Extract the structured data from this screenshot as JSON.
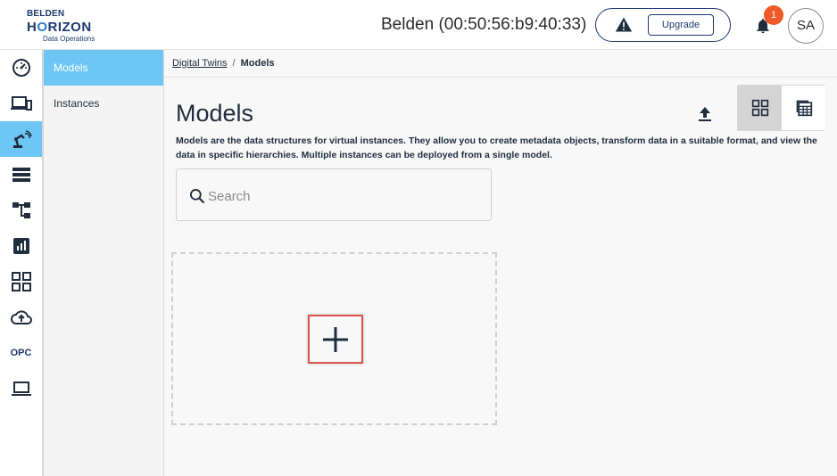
{
  "header": {
    "logo": {
      "line1": "BELDEN",
      "line2_a": "H",
      "line2_o": "O",
      "line2_b": "RIZON",
      "line3": "Data Operations"
    },
    "device_title": "Belden (00:50:56:b9:40:33)",
    "upgrade_label": "Upgrade",
    "notification_count": "1",
    "avatar_initials": "SA"
  },
  "rail": {
    "items": [
      {
        "icon": "dashboard-gauge-icon"
      },
      {
        "icon": "devices-icon"
      },
      {
        "icon": "digital-twins-icon",
        "active": true
      },
      {
        "icon": "list-icon"
      },
      {
        "icon": "hierarchy-icon"
      },
      {
        "icon": "analytics-icon"
      },
      {
        "icon": "apps-grid-icon"
      },
      {
        "icon": "cloud-upload-icon"
      },
      {
        "label": "OPC"
      },
      {
        "icon": "laptop-icon"
      }
    ]
  },
  "subnav": {
    "items": [
      {
        "label": "Models",
        "active": true
      },
      {
        "label": "Instances"
      }
    ]
  },
  "main": {
    "breadcrumb": {
      "parent": "Digital Twins",
      "separator": "/",
      "current": "Models"
    },
    "title": "Models",
    "description": "Models are the data structures for virtual instances. They allow you to create metadata objects, transform data in a suitable format, and view the data in specific hierarchies. Multiple instances can be deployed from a single model.",
    "search_placeholder": "Search",
    "view_mode": "grid"
  },
  "colors": {
    "accent": "#6ec6f5",
    "brand": "#1c3a6e",
    "badge": "#f05a28",
    "highlight": "#d9534f"
  }
}
